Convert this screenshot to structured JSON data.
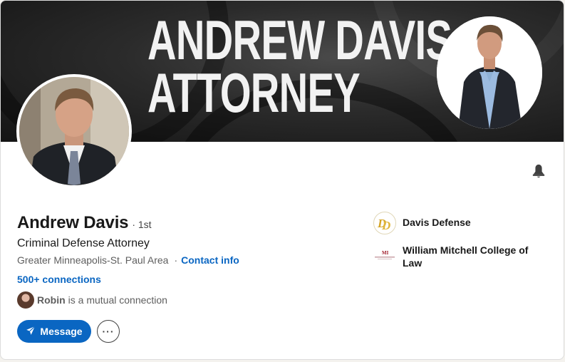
{
  "banner": {
    "title_line1": "ANDREW DAVIS",
    "title_line2": "ATTORNEY"
  },
  "profile": {
    "name": "Andrew Davis",
    "degree": "· 1st",
    "headline": "Criminal Defense Attorney",
    "location": "Greater Minneapolis-St. Paul Area",
    "separator": "·",
    "contact_info": "Contact info",
    "connections": "500+ connections",
    "mutual_name": "Robin",
    "mutual_text": "is a mutual connection"
  },
  "actions": {
    "message_label": "Message",
    "more_label": "···"
  },
  "experience": [
    {
      "name": "Davis Defense",
      "logo_text": "DD"
    },
    {
      "name": "William Mitchell College of Law",
      "logo_text": "WM"
    }
  ],
  "icons": {
    "bell": "bell-icon",
    "send": "paper-plane-icon",
    "more": "more-icon"
  },
  "colors": {
    "accent": "#0a66c2",
    "text": "#191919",
    "muted": "#5e5e5e",
    "logo_gold": "#d4a526"
  }
}
